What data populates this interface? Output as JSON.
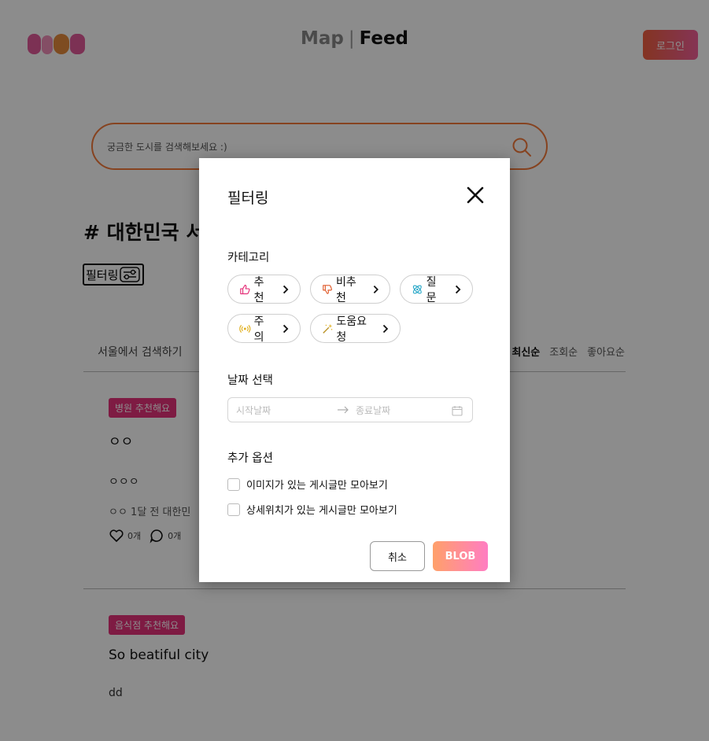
{
  "header": {
    "logo_text": "BLOB",
    "nav_map": "Map",
    "nav_sep": "|",
    "nav_feed": "Feed",
    "login_label": "로그인"
  },
  "search": {
    "placeholder": "궁금한 도시를 검색해보세요 :)"
  },
  "feed": {
    "city_title": "# 대한민국 서",
    "filter_label": "필터링",
    "location_tab": "서울에서 검색하기",
    "sort_tabs": [
      "최신순",
      "조회순",
      "좋아요순"
    ],
    "posts": [
      {
        "badge": "병원 추천해요",
        "title": "ㅇㅇ",
        "body": "ㅇㅇㅇ",
        "meta": "ㅇㅇ 1달 전 대한민",
        "likes": "0개",
        "comments": "0개"
      },
      {
        "badge": "음식점 추천해요",
        "title": "So beatiful city",
        "body": "dd"
      }
    ]
  },
  "modal": {
    "title": "필터링",
    "category_label": "카테고리",
    "categories": [
      {
        "label": "추천",
        "icon": "thumbs-up-icon",
        "color": "#e5327a"
      },
      {
        "label": "비추천",
        "icon": "thumbs-down-icon",
        "color": "#e05a2a"
      },
      {
        "label": "질문",
        "icon": "atom-icon",
        "color": "#2aa8c8"
      },
      {
        "label": "주의",
        "icon": "broadcast-icon",
        "color": "#e0b020"
      },
      {
        "label": "도움요청",
        "icon": "magic-wand-icon",
        "color": "#b89020"
      }
    ],
    "date_label": "날짜 선택",
    "start_placeholder": "시작날짜",
    "end_placeholder": "종료날짜",
    "options_label": "추가 옵션",
    "options": [
      "이미지가 있는 게시글만 모아보기",
      "상세위치가 있는 게시글만 모아보기"
    ],
    "cancel_label": "취소",
    "submit_label": "BLOB"
  }
}
